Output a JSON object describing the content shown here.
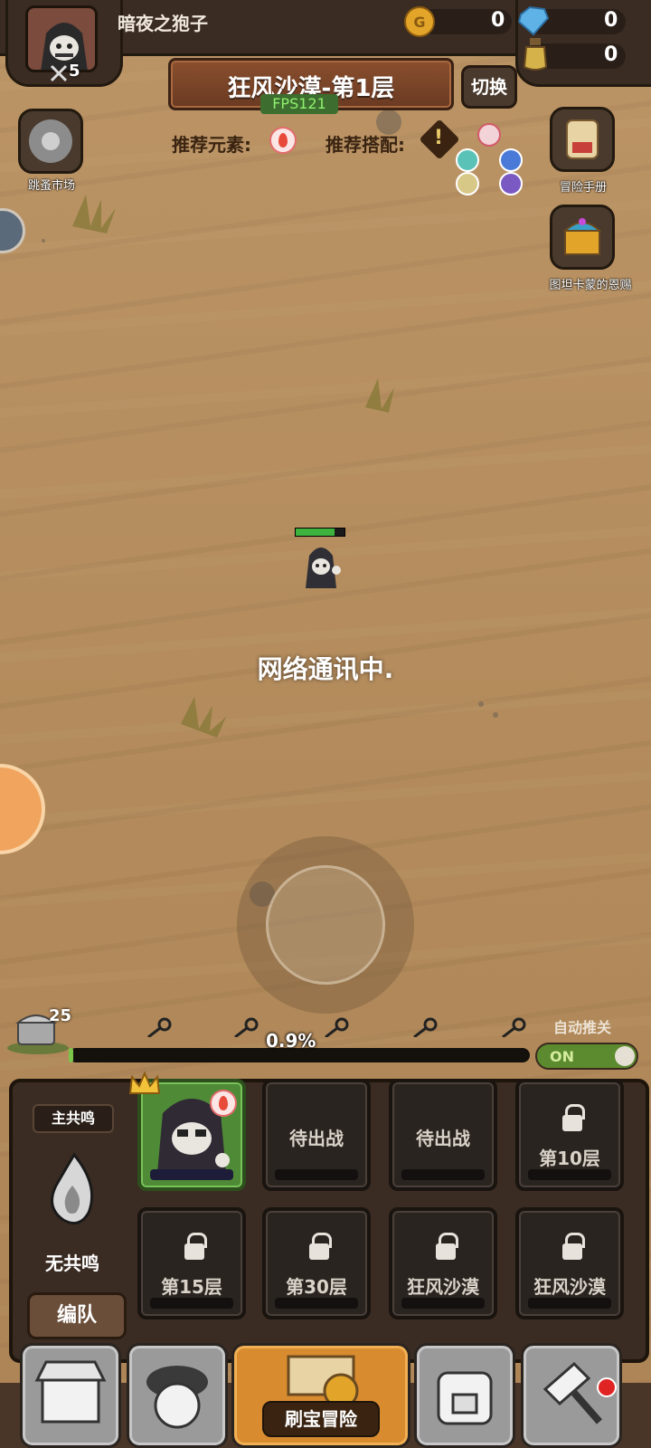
{
  "player": {
    "name": "暗夜之狍子",
    "level": "5"
  },
  "resources": {
    "gold": "0",
    "gems": "0",
    "potion": "0"
  },
  "stage": {
    "title": "狂风沙漠-第1层",
    "fps": "FPS121",
    "switch_label": "切换",
    "recommend_element_label": "推荐元素:",
    "recommend_combo_label": "推荐搭配:"
  },
  "side_buttons": {
    "flea_market": "跳蚤市场",
    "adventure_manual": "冒险手册",
    "gift": "图坦卡蒙的恩赐"
  },
  "status_text": "网络通讯中.",
  "progress": {
    "chest_count": "25",
    "percent_text": "0.9%",
    "value": 0.009,
    "auto_push_label": "自动推关",
    "toggle_state": "ON"
  },
  "hero": {
    "hp_fraction": 0.8
  },
  "team": {
    "resonance_title": "主共鸣",
    "resonance_state": "无共鸣",
    "formation_button": "编队",
    "slots": [
      {
        "label": ""
      },
      {
        "label": "待出战"
      },
      {
        "label": "待出战"
      },
      {
        "label": "第10层"
      },
      {
        "label": "第15层"
      },
      {
        "label": "第30层"
      },
      {
        "label": "狂风沙漠"
      },
      {
        "label": "狂风沙漠"
      }
    ]
  },
  "bottom_nav": {
    "active_label": "刷宝冒险"
  },
  "colors": {
    "sand": "#b89263",
    "panel": "#3a2c22",
    "hp_green": "#3db33d",
    "active_tab": "#d98b2f"
  }
}
